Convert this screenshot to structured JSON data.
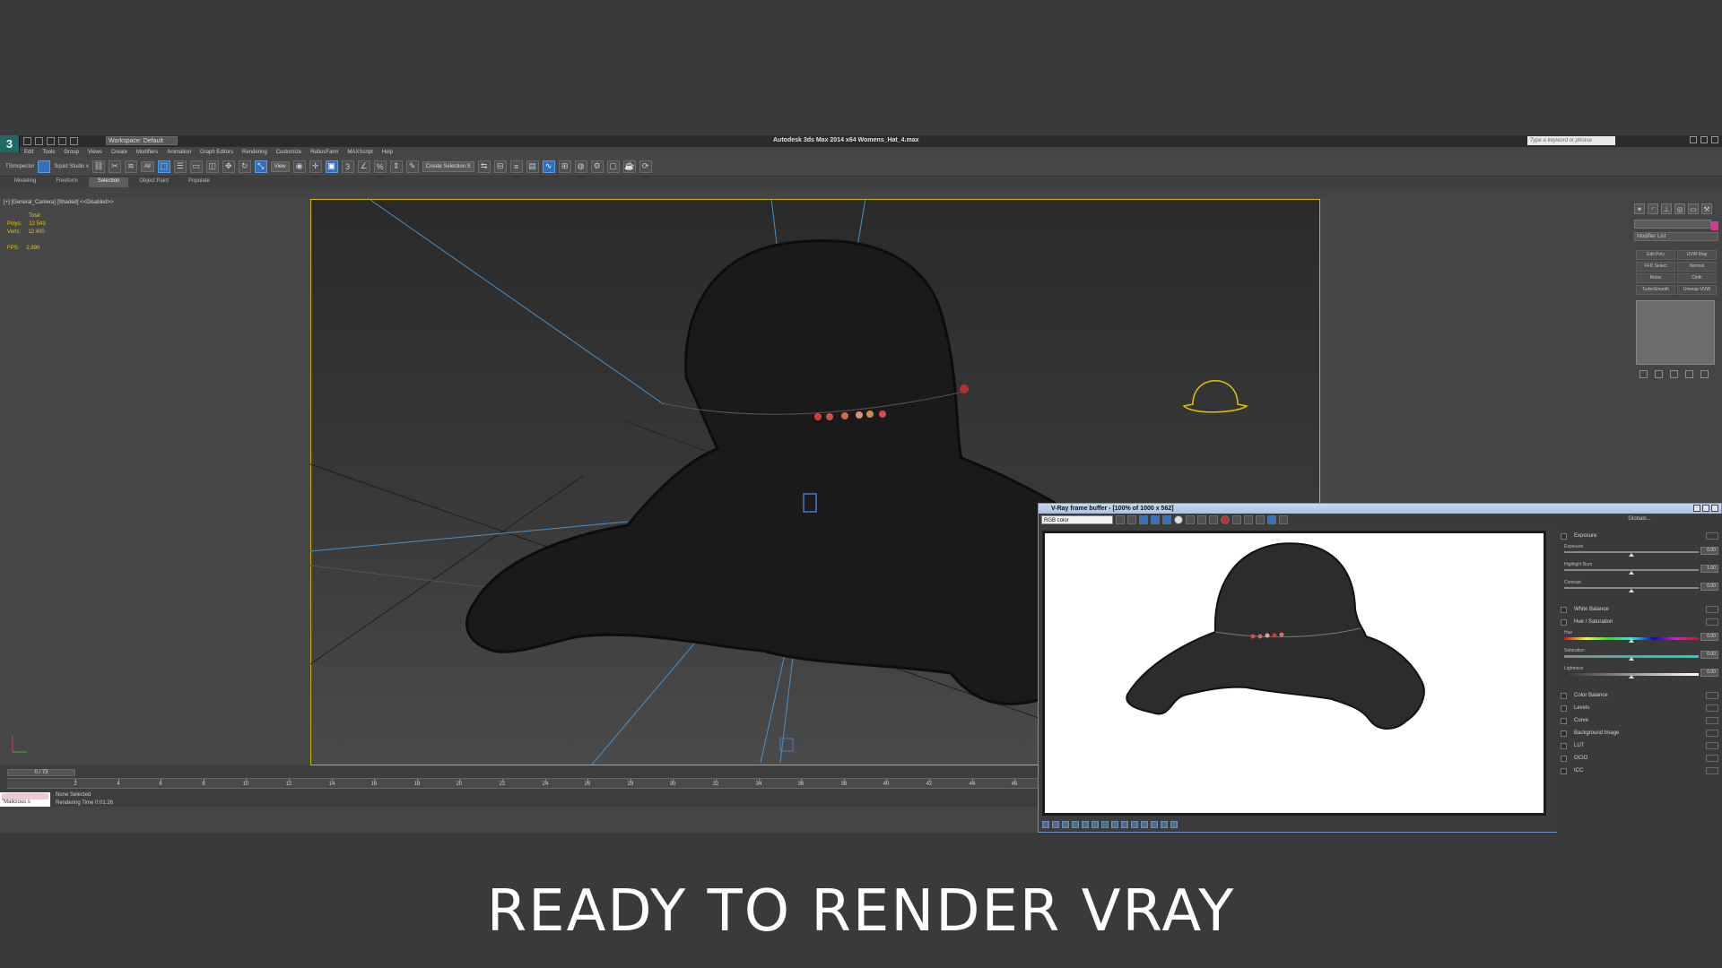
{
  "app": {
    "logo_glyph": "3",
    "workspace": "Workspace: Default",
    "title": "Autodesk 3ds Max  2014 x64    Womens_Hat_4.max",
    "search_placeholder": "Type a keyword or phrase"
  },
  "menu": [
    "Edit",
    "Tools",
    "Group",
    "Views",
    "Create",
    "Modifiers",
    "Animation",
    "Graph Editors",
    "Rendering",
    "Customize",
    "RebusFarm",
    "MAXScript",
    "Help"
  ],
  "toolbar": {
    "plugin1": "TSInspector",
    "plugin2": "Squid Studio v",
    "filter": "All",
    "ref_coord": "View",
    "selection_set": "Create Selection S"
  },
  "ribbon_tabs": [
    {
      "label": "Modeling",
      "active": false
    },
    {
      "label": "Freeform",
      "active": false
    },
    {
      "label": "Selection",
      "active": true
    },
    {
      "label": "Object Paint",
      "active": false
    },
    {
      "label": "Populate",
      "active": false
    }
  ],
  "viewport": {
    "label": "[+] [General_Camera] [Shaded] <<Disabled>>",
    "stats": {
      "total_label": "Total",
      "polys_label": "Polys:",
      "polys": "12 543",
      "verts_label": "Verts:",
      "verts": "12 400",
      "fps_label": "FPS:",
      "fps": "2,890"
    }
  },
  "command_panel": {
    "modifier_list": "Modifier List",
    "modifiers": [
      "Edit Poly",
      "UVW Map",
      "FFD Select",
      "Normal",
      "Relax",
      "Cloth",
      "TurboSmooth",
      "Unwrap UVW"
    ]
  },
  "timeline": {
    "frame": "0 / 73",
    "ticks": [
      "2",
      "4",
      "6",
      "8",
      "10",
      "12",
      "14",
      "16",
      "18",
      "20",
      "22",
      "24",
      "26",
      "28",
      "30",
      "32",
      "34",
      "36",
      "38",
      "40",
      "42",
      "44",
      "46"
    ]
  },
  "status": {
    "maxscript": "\"Malicious s",
    "selection": "None Selected",
    "render_time": "Rendering Time  0:01:26"
  },
  "vfb": {
    "title": "V-Ray frame buffer - [100% of 1000 x 562]",
    "channel": "RGB color",
    "globals": "Globals...",
    "rows": [
      "Exposure",
      "White Balance",
      "Hue / Saturation",
      "Color Balance",
      "Levels",
      "Curve",
      "Background Image",
      "LUT",
      "OCIO",
      "ICC"
    ],
    "sliders": [
      {
        "label": "Exposure",
        "value": "0.00"
      },
      {
        "label": "Highlight Burn",
        "value": "1.00"
      },
      {
        "label": "Contrast",
        "value": "0.00"
      },
      {
        "label": "Hue",
        "value": "0.00"
      },
      {
        "label": "Saturation",
        "value": "0.00"
      },
      {
        "label": "Lightness",
        "value": "0.00"
      }
    ]
  },
  "caption": "READY TO RENDER  VRAY"
}
